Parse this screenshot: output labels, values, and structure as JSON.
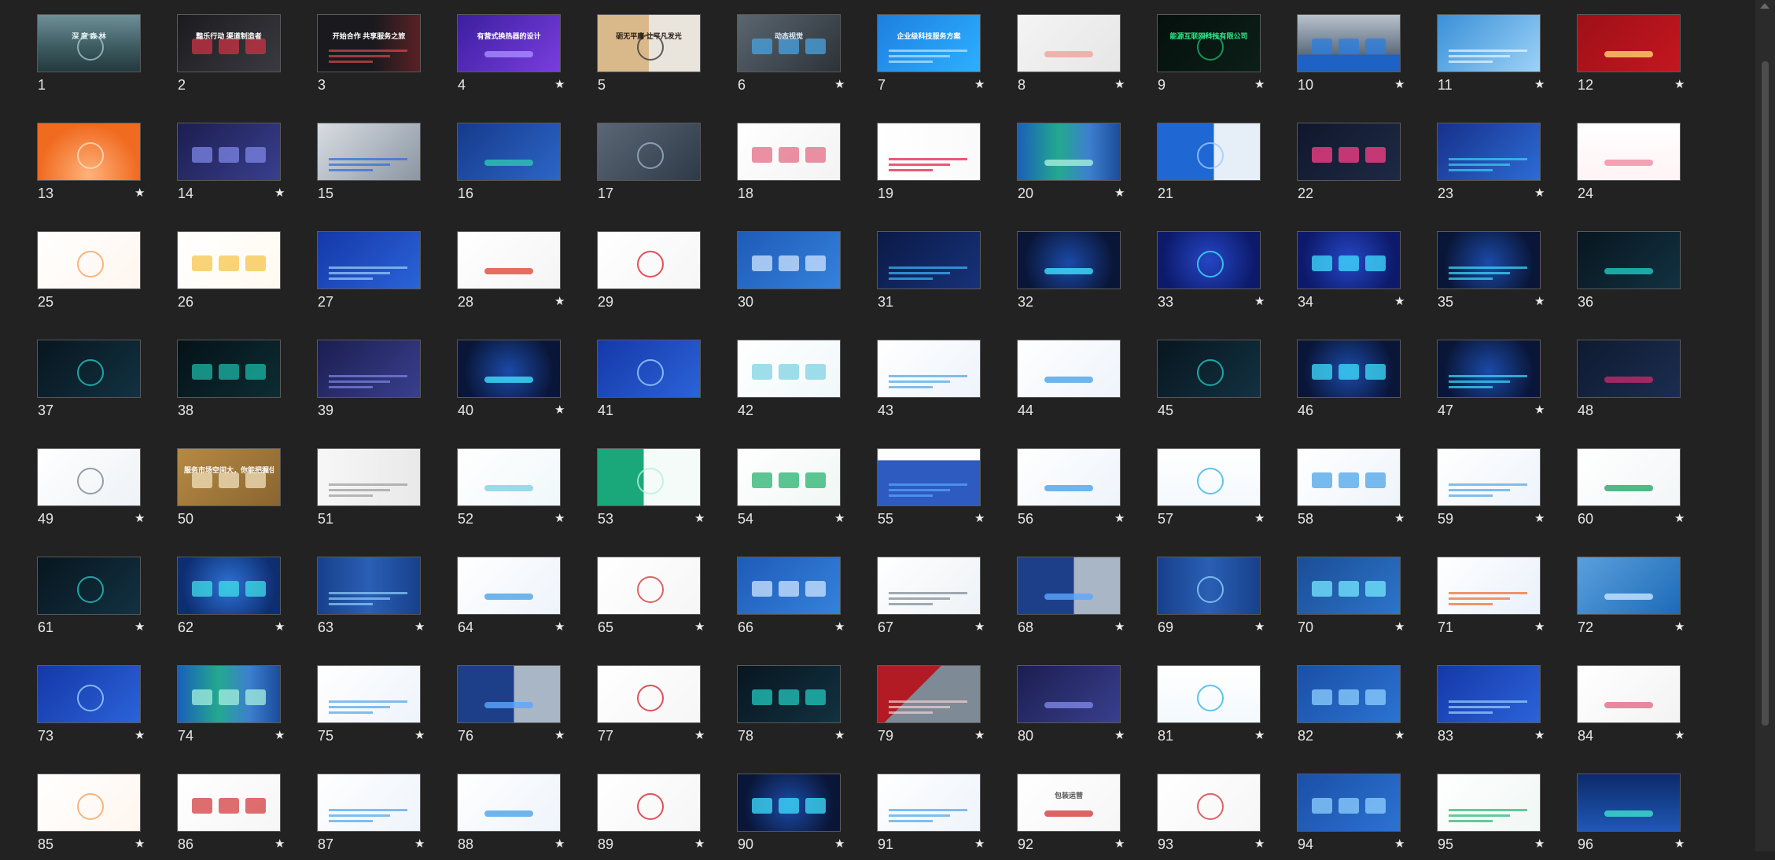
{
  "slides": [
    {
      "num": "1",
      "star": false,
      "theme": "forest",
      "title": "深 度 森 林"
    },
    {
      "num": "2",
      "star": false,
      "theme": "dark",
      "title": "黯乐行动 渠道制造者"
    },
    {
      "num": "3",
      "star": false,
      "theme": "darkred",
      "title": "开始合作 共享服务之旅"
    },
    {
      "num": "4",
      "star": true,
      "theme": "purple",
      "title": "有营式换热器的设计"
    },
    {
      "num": "5",
      "star": false,
      "theme": "beige",
      "title": "砺无平庸 让平凡发光"
    },
    {
      "num": "6",
      "star": true,
      "theme": "gray",
      "title": "动态视觉"
    },
    {
      "num": "7",
      "star": true,
      "theme": "blue",
      "title": "企业级科技服务方案"
    },
    {
      "num": "8",
      "star": true,
      "theme": "light",
      "title": ""
    },
    {
      "num": "9",
      "star": true,
      "theme": "black-green",
      "title": "能源互联网科技有限公司"
    },
    {
      "num": "10",
      "star": true,
      "theme": "building",
      "title": ""
    },
    {
      "num": "11",
      "star": true,
      "theme": "sky",
      "title": ""
    },
    {
      "num": "12",
      "star": true,
      "theme": "red",
      "title": ""
    },
    {
      "num": "13",
      "star": true,
      "theme": "orange",
      "title": ""
    },
    {
      "num": "14",
      "star": true,
      "theme": "navy",
      "title": ""
    },
    {
      "num": "15",
      "star": false,
      "theme": "office",
      "title": ""
    },
    {
      "num": "16",
      "star": false,
      "theme": "blue-circles",
      "title": ""
    },
    {
      "num": "17",
      "star": false,
      "theme": "slate",
      "title": ""
    },
    {
      "num": "18",
      "star": false,
      "theme": "pink-white",
      "title": ""
    },
    {
      "num": "19",
      "star": false,
      "theme": "red-white",
      "title": ""
    },
    {
      "num": "20",
      "star": true,
      "theme": "teal-panels",
      "title": ""
    },
    {
      "num": "21",
      "star": false,
      "theme": "blue-white",
      "title": ""
    },
    {
      "num": "22",
      "star": false,
      "theme": "dark-pink",
      "title": ""
    },
    {
      "num": "23",
      "star": true,
      "theme": "blue-contents",
      "title": ""
    },
    {
      "num": "24",
      "star": false,
      "theme": "pink-bars",
      "title": ""
    },
    {
      "num": "25",
      "star": false,
      "theme": "orange-white",
      "title": ""
    },
    {
      "num": "26",
      "star": false,
      "theme": "yellow-white",
      "title": ""
    },
    {
      "num": "27",
      "star": false,
      "theme": "royal",
      "title": ""
    },
    {
      "num": "28",
      "star": true,
      "theme": "white-orange",
      "title": ""
    },
    {
      "num": "29",
      "star": false,
      "theme": "white-red",
      "title": ""
    },
    {
      "num": "30",
      "star": false,
      "theme": "map-blue",
      "title": ""
    },
    {
      "num": "31",
      "star": false,
      "theme": "navy-circles",
      "title": ""
    },
    {
      "num": "32",
      "star": false,
      "theme": "navy-glow",
      "title": ""
    },
    {
      "num": "33",
      "star": true,
      "theme": "deep-blue",
      "title": ""
    },
    {
      "num": "34",
      "star": true,
      "theme": "deep-blue",
      "title": ""
    },
    {
      "num": "35",
      "star": true,
      "theme": "navy-glow",
      "title": ""
    },
    {
      "num": "36",
      "star": false,
      "theme": "dark-teal",
      "title": ""
    },
    {
      "num": "37",
      "star": false,
      "theme": "dark-teal",
      "title": ""
    },
    {
      "num": "38",
      "star": false,
      "theme": "teal-dark",
      "title": ""
    },
    {
      "num": "39",
      "star": false,
      "theme": "navy",
      "title": ""
    },
    {
      "num": "40",
      "star": true,
      "theme": "navy-glow",
      "title": ""
    },
    {
      "num": "41",
      "star": false,
      "theme": "royal",
      "title": ""
    },
    {
      "num": "42",
      "star": false,
      "theme": "white-teal",
      "title": ""
    },
    {
      "num": "43",
      "star": false,
      "theme": "white-blue",
      "title": ""
    },
    {
      "num": "44",
      "star": false,
      "theme": "white-blue",
      "title": ""
    },
    {
      "num": "45",
      "star": false,
      "theme": "dark-teal",
      "title": ""
    },
    {
      "num": "46",
      "star": false,
      "theme": "navy-glow",
      "title": ""
    },
    {
      "num": "47",
      "star": true,
      "theme": "navy-glow",
      "title": ""
    },
    {
      "num": "48",
      "star": false,
      "theme": "dark-magenta",
      "title": ""
    },
    {
      "num": "49",
      "star": true,
      "theme": "white-people",
      "title": ""
    },
    {
      "num": "50",
      "star": false,
      "theme": "gold",
      "title": "服务市场空间大，你能把握住吗？"
    },
    {
      "num": "51",
      "star": false,
      "theme": "white-man",
      "title": ""
    },
    {
      "num": "52",
      "star": true,
      "theme": "white-teal",
      "title": ""
    },
    {
      "num": "53",
      "star": true,
      "theme": "green-white",
      "title": ""
    },
    {
      "num": "54",
      "star": true,
      "theme": "white-green",
      "title": ""
    },
    {
      "num": "55",
      "star": true,
      "theme": "blue-grid",
      "title": ""
    },
    {
      "num": "56",
      "star": true,
      "theme": "white-blue",
      "title": ""
    },
    {
      "num": "57",
      "star": true,
      "theme": "white-chart",
      "title": ""
    },
    {
      "num": "58",
      "star": true,
      "theme": "white-blue",
      "title": ""
    },
    {
      "num": "59",
      "star": true,
      "theme": "white-blue",
      "title": ""
    },
    {
      "num": "60",
      "star": true,
      "theme": "white-diamond",
      "title": ""
    },
    {
      "num": "61",
      "star": true,
      "theme": "dark-teal",
      "title": ""
    },
    {
      "num": "62",
      "star": true,
      "theme": "blue-glow",
      "title": ""
    },
    {
      "num": "63",
      "star": true,
      "theme": "blue-columns",
      "title": ""
    },
    {
      "num": "64",
      "star": true,
      "theme": "white-blue",
      "title": ""
    },
    {
      "num": "65",
      "star": true,
      "theme": "white-plain",
      "title": ""
    },
    {
      "num": "66",
      "star": true,
      "theme": "map-blue",
      "title": ""
    },
    {
      "num": "67",
      "star": true,
      "theme": "white-people",
      "title": ""
    },
    {
      "num": "68",
      "star": true,
      "theme": "blue-photo",
      "title": ""
    },
    {
      "num": "69",
      "star": true,
      "theme": "blue-columns",
      "title": ""
    },
    {
      "num": "70",
      "star": true,
      "theme": "blue-hex",
      "title": ""
    },
    {
      "num": "71",
      "star": true,
      "theme": "white-triangle",
      "title": ""
    },
    {
      "num": "72",
      "star": true,
      "theme": "city",
      "title": ""
    },
    {
      "num": "73",
      "star": true,
      "theme": "royal",
      "title": ""
    },
    {
      "num": "74",
      "star": true,
      "theme": "teal-panels",
      "title": ""
    },
    {
      "num": "75",
      "star": true,
      "theme": "white-blue",
      "title": ""
    },
    {
      "num": "76",
      "star": true,
      "theme": "blue-photo",
      "title": ""
    },
    {
      "num": "77",
      "star": true,
      "theme": "white-red",
      "title": ""
    },
    {
      "num": "78",
      "star": true,
      "theme": "dark-teal",
      "title": ""
    },
    {
      "num": "79",
      "star": true,
      "theme": "red-car",
      "title": ""
    },
    {
      "num": "80",
      "star": true,
      "theme": "navy",
      "title": ""
    },
    {
      "num": "81",
      "star": true,
      "theme": "white-chart",
      "title": ""
    },
    {
      "num": "82",
      "star": true,
      "theme": "blue-bars",
      "title": ""
    },
    {
      "num": "83",
      "star": true,
      "theme": "royal",
      "title": ""
    },
    {
      "num": "84",
      "star": true,
      "theme": "pink-white",
      "title": ""
    },
    {
      "num": "85",
      "star": true,
      "theme": "orange-white",
      "title": ""
    },
    {
      "num": "86",
      "star": true,
      "theme": "white-plain",
      "title": ""
    },
    {
      "num": "87",
      "star": true,
      "theme": "white-blue",
      "title": ""
    },
    {
      "num": "88",
      "star": true,
      "theme": "white-blue",
      "title": ""
    },
    {
      "num": "89",
      "star": true,
      "theme": "white-red",
      "title": ""
    },
    {
      "num": "90",
      "star": true,
      "theme": "navy-glow",
      "title": ""
    },
    {
      "num": "91",
      "star": true,
      "theme": "white-blue",
      "title": ""
    },
    {
      "num": "92",
      "star": true,
      "theme": "white-plain",
      "title": "包装运营"
    },
    {
      "num": "93",
      "star": true,
      "theme": "white-plain",
      "title": ""
    },
    {
      "num": "94",
      "star": true,
      "theme": "blue-bars",
      "title": ""
    },
    {
      "num": "95",
      "star": true,
      "theme": "white-green",
      "title": ""
    },
    {
      "num": "96",
      "star": true,
      "theme": "navy-city",
      "title": ""
    }
  ],
  "themes": {
    "forest": {
      "bg": "linear-gradient(180deg,#6f8f98 0%,#3e5d63 55%,#23393d 100%)",
      "fg": "#e8f2f3",
      "accent": "#9fc4c9"
    },
    "dark": {
      "bg": "linear-gradient(135deg,#1b1b1f,#3a3a40)",
      "fg": "#ffffff",
      "accent": "#cc3344"
    },
    "darkred": {
      "bg": "linear-gradient(90deg,#1a1a1e 55%,#5a2025 100%)",
      "fg": "#ffffff",
      "accent": "#d94a4a"
    },
    "purple": {
      "bg": "linear-gradient(135deg,#3b1f9e,#7a3de0)",
      "fg": "#ffffff",
      "accent": "#a98cff"
    },
    "beige": {
      "bg": "linear-gradient(90deg,#d9b98a 50%,#e9e4dc 50%)",
      "fg": "#2a2018",
      "accent": "#3a3a3a"
    },
    "gray": {
      "bg": "linear-gradient(135deg,#5b6670,#2c3238)",
      "fg": "#e0f0ff",
      "accent": "#49a3e0"
    },
    "blue": {
      "bg": "linear-gradient(135deg,#1e7fe0,#2cb0ff)",
      "fg": "#ffffff",
      "accent": "#bfe6ff"
    },
    "light": {
      "bg": "linear-gradient(135deg,#f4f4f4,#e6e6e6)",
      "fg": "#d6453a",
      "accent": "#f0a39c"
    },
    "black-green": {
      "bg": "linear-gradient(135deg,#05100c,#0c1f18)",
      "fg": "#2ee88a",
      "accent": "#19b46a"
    },
    "building": {
      "bg": "linear-gradient(180deg,#b8c2cc,#5b6b7c 70%,#1d62c4 70%)",
      "fg": "#ffffff",
      "accent": "#2a7de1"
    },
    "sky": {
      "bg": "linear-gradient(135deg,#3a90d8,#9cd2f7)",
      "fg": "#ffffff",
      "accent": "#e8f6ff"
    },
    "red": {
      "bg": "linear-gradient(135deg,#9e1018,#c4161f)",
      "fg": "#ffffff",
      "accent": "#ffd36b"
    },
    "orange": {
      "bg": "radial-gradient(circle at 50% 90%,#ffb27a,#f06a1f 70%)",
      "fg": "#ffffff",
      "accent": "#ffe0c8"
    },
    "navy": {
      "bg": "linear-gradient(135deg,#1b1e4f,#3a3f8f)",
      "fg": "#ffffff",
      "accent": "#7d86e6"
    },
    "office": {
      "bg": "linear-gradient(135deg,#d9dde2,#8a96a3)",
      "fg": "#1c2733",
      "accent": "#2f6ad8"
    },
    "blue-circles": {
      "bg": "linear-gradient(135deg,#163a8a,#2c66c8)",
      "fg": "#ffffff",
      "accent": "#2fc6b2"
    },
    "slate": {
      "bg": "linear-gradient(135deg,#5b6776,#2f3a48)",
      "fg": "#ffffff",
      "accent": "#9ab3cc"
    },
    "pink-white": {
      "bg": "linear-gradient(135deg,#ffffff,#f3f3f3)",
      "fg": "#d23a5a",
      "accent": "#e56b86"
    },
    "red-white": {
      "bg": "linear-gradient(90deg,#ffffff,#fafafa)",
      "fg": "#e0163f",
      "accent": "#e0163f"
    },
    "teal-panels": {
      "bg": "linear-gradient(90deg,#1b5fb8 0%,#23a98f 40%,#3d7fcf 70%,#1b4c9a 100%)",
      "fg": "#ffffff",
      "accent": "#a6f0df"
    },
    "blue-white": {
      "bg": "linear-gradient(90deg,#1f67d3 55%,#e6eef8 55%)",
      "fg": "#ffffff",
      "accent": "#9fc9ff"
    },
    "dark-pink": {
      "bg": "linear-gradient(135deg,#10172b,#1d2a45)",
      "fg": "#ffffff",
      "accent": "#ff3f8a"
    },
    "blue-contents": {
      "bg": "linear-gradient(135deg,#17308a,#2d6cd6)",
      "fg": "#ffffff",
      "accent": "#3fd1f2"
    },
    "pink-bars": {
      "bg": "linear-gradient(180deg,#ffffff,#fff3f5)",
      "fg": "#e04a6e",
      "accent": "#f38aa2"
    },
    "orange-white": {
      "bg": "linear-gradient(135deg,#ffffff,#fff6ef)",
      "fg": "#f27a2a",
      "accent": "#f7a35c"
    },
    "yellow-white": {
      "bg": "linear-gradient(135deg,#ffffff,#fffaf0)",
      "fg": "#f0a417",
      "accent": "#f6c64a"
    },
    "royal": {
      "bg": "linear-gradient(135deg,#1538a8,#2b63d9)",
      "fg": "#ffffff",
      "accent": "#9cd1ff"
    },
    "white-orange": {
      "bg": "linear-gradient(135deg,#ffffff,#f5f5f5)",
      "fg": "#f07a1a",
      "accent": "#e04a3a"
    },
    "white-red": {
      "bg": "linear-gradient(135deg,#ffffff,#f6f6f6)",
      "fg": "#d9252f",
      "accent": "#d9252f"
    },
    "map-blue": {
      "bg": "linear-gradient(135deg,#1e5bb8,#3582db)",
      "fg": "#ffffff",
      "accent": "#cfe5ff"
    },
    "navy-circles": {
      "bg": "linear-gradient(135deg,#0b1a46,#17327a)",
      "fg": "#ffffff",
      "accent": "#3fb8ff"
    },
    "navy-glow": {
      "bg": "radial-gradient(circle at 50% 55%,#1b4aa8,#0a1638 75%)",
      "fg": "#ffffff",
      "accent": "#3fe0ff"
    },
    "deep-blue": {
      "bg": "radial-gradient(circle at 50% 50%,#2446c6,#0d1a6a 80%)",
      "fg": "#ffffff",
      "accent": "#3fe0ff"
    },
    "dark-teal": {
      "bg": "linear-gradient(135deg,#08161f,#123141)",
      "fg": "#5ff0e0",
      "accent": "#22c8c0"
    },
    "teal-dark": {
      "bg": "linear-gradient(135deg,#051217,#0d2c33)",
      "fg": "#3ff2d8",
      "accent": "#1cb7a6"
    },
    "white-teal": {
      "bg": "linear-gradient(135deg,#ffffff,#f0f8fa)",
      "fg": "#1fb0c8",
      "accent": "#7fd3e3"
    },
    "white-blue": {
      "bg": "linear-gradient(135deg,#ffffff,#eef4fb)",
      "fg": "#1c62c9",
      "accent": "#4ba4e8"
    },
    "dark-magenta": {
      "bg": "linear-gradient(135deg,#0e1a30,#1b2d4f)",
      "fg": "#ffffff",
      "accent": "#c02a6a"
    },
    "white-people": {
      "bg": "linear-gradient(135deg,#ffffff,#eef2f6)",
      "fg": "#2a5db0",
      "accent": "#7a8794"
    },
    "gold": {
      "bg": "linear-gradient(135deg,#b58a45,#8a6530)",
      "fg": "#ffffff",
      "accent": "#f3e1bd"
    },
    "white-man": {
      "bg": "linear-gradient(90deg,#f7f7f7,#e9e9e9)",
      "fg": "#333333",
      "accent": "#9a9a9a"
    },
    "green-white": {
      "bg": "linear-gradient(90deg,#1aa87a 45%,#f5fbf9 45%)",
      "fg": "#ffffff",
      "accent": "#b8f0dc"
    },
    "white-green": {
      "bg": "linear-gradient(135deg,#ffffff,#f0f7f4)",
      "fg": "#1f8fd0",
      "accent": "#27b36d"
    },
    "blue-grid": {
      "bg": "linear-gradient(180deg,#ffffff 20%,#2d5bbf 20%)",
      "fg": "#ffffff",
      "accent": "#5aa6ff"
    },
    "white-chart": {
      "bg": "linear-gradient(180deg,#ffffff,#f4f9fd)",
      "fg": "#1d8ad2",
      "accent": "#34b6e2"
    },
    "white-diamond": {
      "bg": "linear-gradient(135deg,#ffffff,#f3f6f7)",
      "fg": "#1a7ec8",
      "accent": "#28a86a"
    },
    "blue-glow": {
      "bg": "radial-gradient(circle at 50% 50%,#2c72d6,#0e2e72 80%)",
      "fg": "#ffffff",
      "accent": "#3fe0e8"
    },
    "blue-columns": {
      "bg": "linear-gradient(90deg,#17408c,#2a5fb4,#17408c)",
      "fg": "#ffffff",
      "accent": "#8fd0ff"
    },
    "white-plain": {
      "bg": "linear-gradient(135deg,#ffffff,#f6f6f6)",
      "fg": "#555555",
      "accent": "#d43d3d"
    },
    "blue-photo": {
      "bg": "linear-gradient(90deg,#1d3f8a 55%,#a9b6c6 55%)",
      "fg": "#ffffff",
      "accent": "#5aa6ff"
    },
    "blue-hex": {
      "bg": "linear-gradient(135deg,#1b4d96,#2c75c9)",
      "fg": "#ffffff",
      "accent": "#76e8ff"
    },
    "white-triangle": {
      "bg": "linear-gradient(135deg,#ffffff,#e9f1fb)",
      "fg": "#1c5fc7",
      "accent": "#f06a2a"
    },
    "city": {
      "bg": "linear-gradient(135deg,#5aa0dc,#1d6ab8)",
      "fg": "#ffffff",
      "accent": "#c8e6ff"
    },
    "red-car": {
      "bg": "linear-gradient(135deg,#b31b24 40%,#7e8a96 40%)",
      "fg": "#ffffff",
      "accent": "#f2d0d2"
    },
    "blue-bars": {
      "bg": "linear-gradient(135deg,#1b4fa6,#2b73d2)",
      "fg": "#ffffff",
      "accent": "#8fd0ff"
    },
    "navy-city": {
      "bg": "linear-gradient(180deg,#0c2a6a,#1f58b5)",
      "fg": "#ffffff",
      "accent": "#3fe0d0"
    }
  },
  "star_glyph": "★",
  "scrollbar": {
    "label": "vertical-scrollbar"
  }
}
